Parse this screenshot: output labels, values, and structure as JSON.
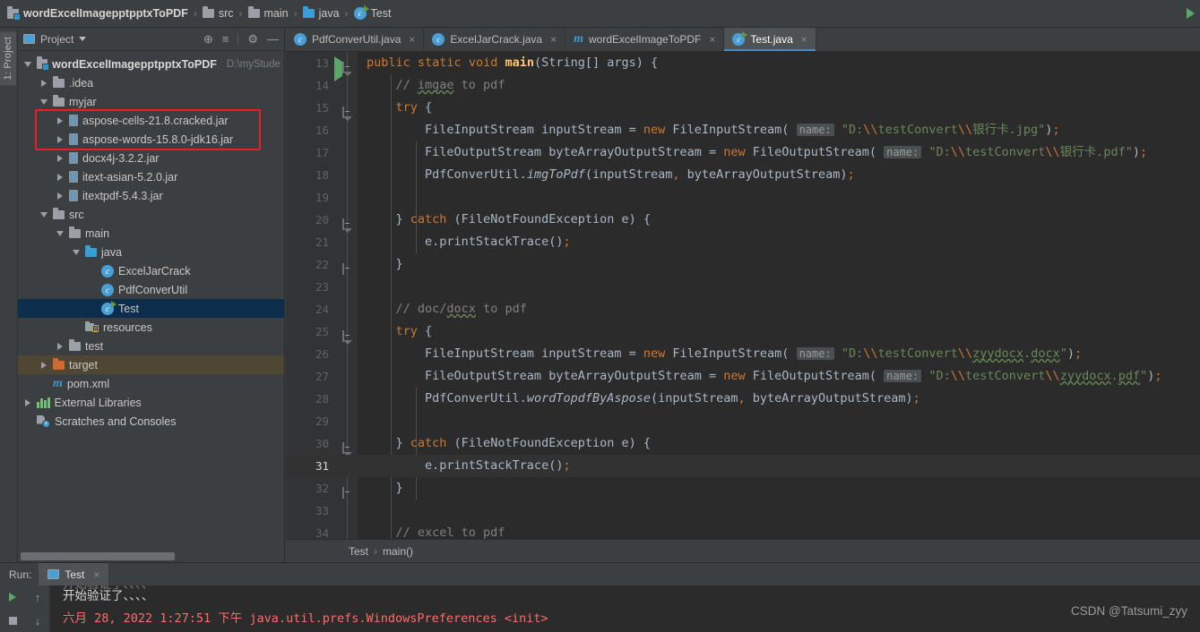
{
  "window": {
    "app": "IntelliJ IDEA",
    "accent": "#4a88c7",
    "background": "#3c3f41",
    "editor_background": "#2b2b2b",
    "annotation_color": "#ee1c25"
  },
  "navbar": {
    "project_name": "wordExcelImagepptpptxToPDF",
    "separator": "›",
    "crumbs": [
      {
        "label": "src",
        "icon": "folder-icon"
      },
      {
        "label": "main",
        "icon": "folder-icon"
      },
      {
        "label": "java",
        "icon": "folder-blue-icon"
      },
      {
        "label": "Test",
        "icon": "java-class-runnable-icon"
      }
    ],
    "run_icon": "run-icon"
  },
  "left_strip": {
    "tool_tab": "1: Project"
  },
  "project_panel": {
    "title": "Project",
    "dropdown_icon": "chevron-down-icon",
    "tools": [
      {
        "name": "locate-icon",
        "glyph": "⊕"
      },
      {
        "name": "collapse-all-icon",
        "glyph": "≡"
      },
      {
        "name": "gear-icon",
        "glyph": "⚙"
      },
      {
        "name": "hide-icon",
        "glyph": "—"
      }
    ],
    "tree": [
      {
        "label": "wordExcelImagepptpptxToPDF",
        "sub": "D:\\myStude",
        "icon": "module-icon",
        "twisty": "down",
        "indent": 0,
        "bold": true
      },
      {
        "label": ".idea",
        "icon": "folder-icon",
        "twisty": "right",
        "indent": 1
      },
      {
        "label": "myjar",
        "icon": "folder-icon",
        "twisty": "down",
        "indent": 1
      },
      {
        "label": "aspose-cells-21.8.cracked.jar",
        "icon": "jar-icon",
        "twisty": "right",
        "indent": 2,
        "annotated": true
      },
      {
        "label": "aspose-words-15.8.0-jdk16.jar",
        "icon": "jar-icon",
        "twisty": "right",
        "indent": 2,
        "annotated": true
      },
      {
        "label": "docx4j-3.2.2.jar",
        "icon": "jar-icon",
        "twisty": "right",
        "indent": 2
      },
      {
        "label": "itext-asian-5.2.0.jar",
        "icon": "jar-icon",
        "twisty": "right",
        "indent": 2
      },
      {
        "label": "itextpdf-5.4.3.jar",
        "icon": "jar-icon",
        "twisty": "right",
        "indent": 2
      },
      {
        "label": "src",
        "icon": "folder-icon",
        "twisty": "down",
        "indent": 1
      },
      {
        "label": "main",
        "icon": "folder-icon",
        "twisty": "down",
        "indent": 2
      },
      {
        "label": "java",
        "icon": "folder-blue-icon",
        "twisty": "down",
        "indent": 3
      },
      {
        "label": "ExcelJarCrack",
        "icon": "java-class-icon",
        "twisty": "none",
        "indent": 4
      },
      {
        "label": "PdfConverUtil",
        "icon": "java-class-icon",
        "twisty": "none",
        "indent": 4
      },
      {
        "label": "Test",
        "icon": "java-class-runnable-icon",
        "twisty": "none",
        "indent": 4,
        "selected": true
      },
      {
        "label": "resources",
        "icon": "resources-folder-icon",
        "twisty": "none",
        "indent": 3
      },
      {
        "label": "test",
        "icon": "folder-icon",
        "twisty": "right",
        "indent": 2
      },
      {
        "label": "target",
        "icon": "folder-orange-icon",
        "twisty": "right",
        "indent": 1,
        "highlight": true
      },
      {
        "label": "pom.xml",
        "icon": "maven-icon",
        "twisty": "none",
        "indent": 1
      },
      {
        "label": "External Libraries",
        "icon": "external-libraries-icon",
        "twisty": "right",
        "indent": 0
      },
      {
        "label": "Scratches and Consoles",
        "icon": "scratches-icon",
        "twisty": "none",
        "indent": 0
      }
    ]
  },
  "editor": {
    "tabs": [
      {
        "label": "PdfConverUtil.java",
        "icon": "java-class-icon",
        "active": false
      },
      {
        "label": "ExcelJarCrack.java",
        "icon": "java-class-icon",
        "active": false
      },
      {
        "label": "wordExcelImageToPDF",
        "icon": "maven-icon",
        "active": false
      },
      {
        "label": "Test.java",
        "icon": "java-class-runnable-icon",
        "active": true
      }
    ],
    "close_glyph": "×",
    "current_line": 31,
    "lines": [
      {
        "num": 13,
        "fold": "open",
        "run": true
      },
      {
        "num": 14
      },
      {
        "num": 15,
        "fold": "open"
      },
      {
        "num": 16
      },
      {
        "num": 17
      },
      {
        "num": 18
      },
      {
        "num": 19
      },
      {
        "num": 20,
        "fold": "open"
      },
      {
        "num": 21
      },
      {
        "num": 22,
        "fold": "close"
      },
      {
        "num": 23
      },
      {
        "num": 24
      },
      {
        "num": 25,
        "fold": "open"
      },
      {
        "num": 26
      },
      {
        "num": 27
      },
      {
        "num": 28
      },
      {
        "num": 29
      },
      {
        "num": 30,
        "fold": "open"
      },
      {
        "num": 31
      },
      {
        "num": 32,
        "fold": "close"
      },
      {
        "num": 33
      },
      {
        "num": 34
      }
    ],
    "code_text": [
      "public static void main(String[] args) {",
      "    // imgae to pdf",
      "    try {",
      "        FileInputStream inputStream = new FileInputStream( name: \"D:\\\\testConvert\\\\银行卡.jpg\");",
      "        FileOutputStream byteArrayOutputStream = new FileOutputStream( name: \"D:\\\\testConvert\\\\银行卡.pdf\");",
      "        PdfConverUtil.imgToPdf(inputStream, byteArrayOutputStream);",
      "",
      "    } catch (FileNotFoundException e) {",
      "        e.printStackTrace();",
      "    }",
      "",
      "    // doc/docx to pdf",
      "    try {",
      "        FileInputStream inputStream = new FileInputStream( name: \"D:\\\\testConvert\\\\zyydocx.docx\");",
      "        FileOutputStream byteArrayOutputStream = new FileOutputStream( name: \"D:\\\\testConvert\\\\zyydocx.pdf\");",
      "        PdfConverUtil.wordTopdfByAspose(inputStream, byteArrayOutputStream);",
      "",
      "    } catch (FileNotFoundException e) {",
      "        e.printStackTrace();",
      "    }",
      "",
      "    // excel to pdf"
    ],
    "parameter_hint": "name:",
    "breadcrumb": {
      "class": "Test",
      "method": "main()",
      "separator": "›"
    }
  },
  "run_panel": {
    "label": "Run:",
    "tab": "Test",
    "close_glyph": "×",
    "controls": [
      {
        "name": "rerun-button",
        "glyph": "▶"
      },
      {
        "name": "scroll-up-button",
        "glyph": "↑"
      },
      {
        "name": "stop-button",
        "glyph": "■"
      },
      {
        "name": "scroll-down-button",
        "glyph": "↓"
      }
    ],
    "console": {
      "clipped_line": "开始验证了、、、、",
      "line1": "开始验证了、、、、",
      "line2": "六月 28, 2022 1:27:51 下午 java.util.prefs.WindowsPreferences <init>"
    }
  },
  "watermark": "CSDN @Tatsumi_zyy"
}
